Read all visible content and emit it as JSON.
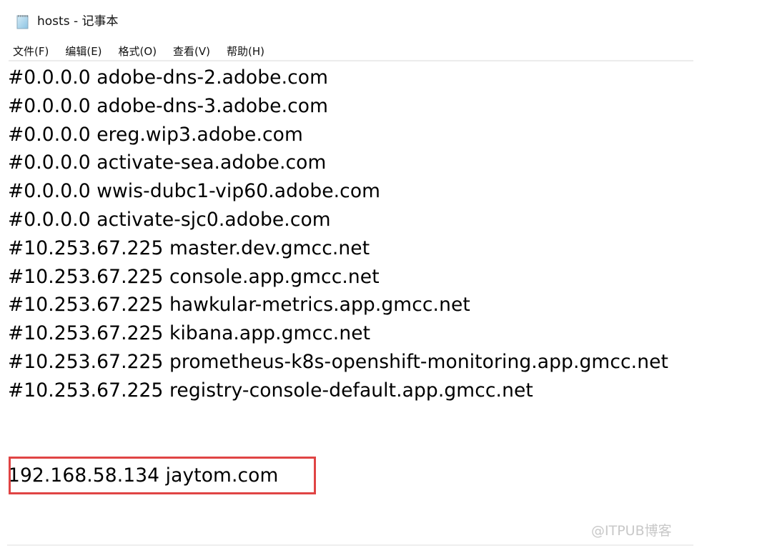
{
  "window": {
    "title": "hosts - 记事本",
    "icon": "notepad-icon"
  },
  "menubar": {
    "items": [
      {
        "label": "文件(F)"
      },
      {
        "label": "编辑(E)"
      },
      {
        "label": "格式(O)"
      },
      {
        "label": "查看(V)"
      },
      {
        "label": "帮助(H)"
      }
    ]
  },
  "editor": {
    "lines": [
      "#0.0.0.0 adobe-dns-2.adobe.com",
      "#0.0.0.0 adobe-dns-3.adobe.com",
      "#0.0.0.0 ereg.wip3.adobe.com",
      "#0.0.0.0 activate-sea.adobe.com",
      "#0.0.0.0 wwis-dubc1-vip60.adobe.com",
      "#0.0.0.0 activate-sjc0.adobe.com",
      "#10.253.67.225 master.dev.gmcc.net",
      "#10.253.67.225 console.app.gmcc.net",
      "#10.253.67.225 hawkular-metrics.app.gmcc.net",
      "#10.253.67.225 kibana.app.gmcc.net",
      "#10.253.67.225 prometheus-k8s-openshift-monitoring.app.gmcc.net",
      "#10.253.67.225 registry-console-default.app.gmcc.net",
      "",
      "",
      "192.168.58.134 jaytom.com"
    ],
    "highlighted_line_index": 14,
    "highlight_color": "#e04444"
  },
  "watermark": "@ITPUB博客"
}
